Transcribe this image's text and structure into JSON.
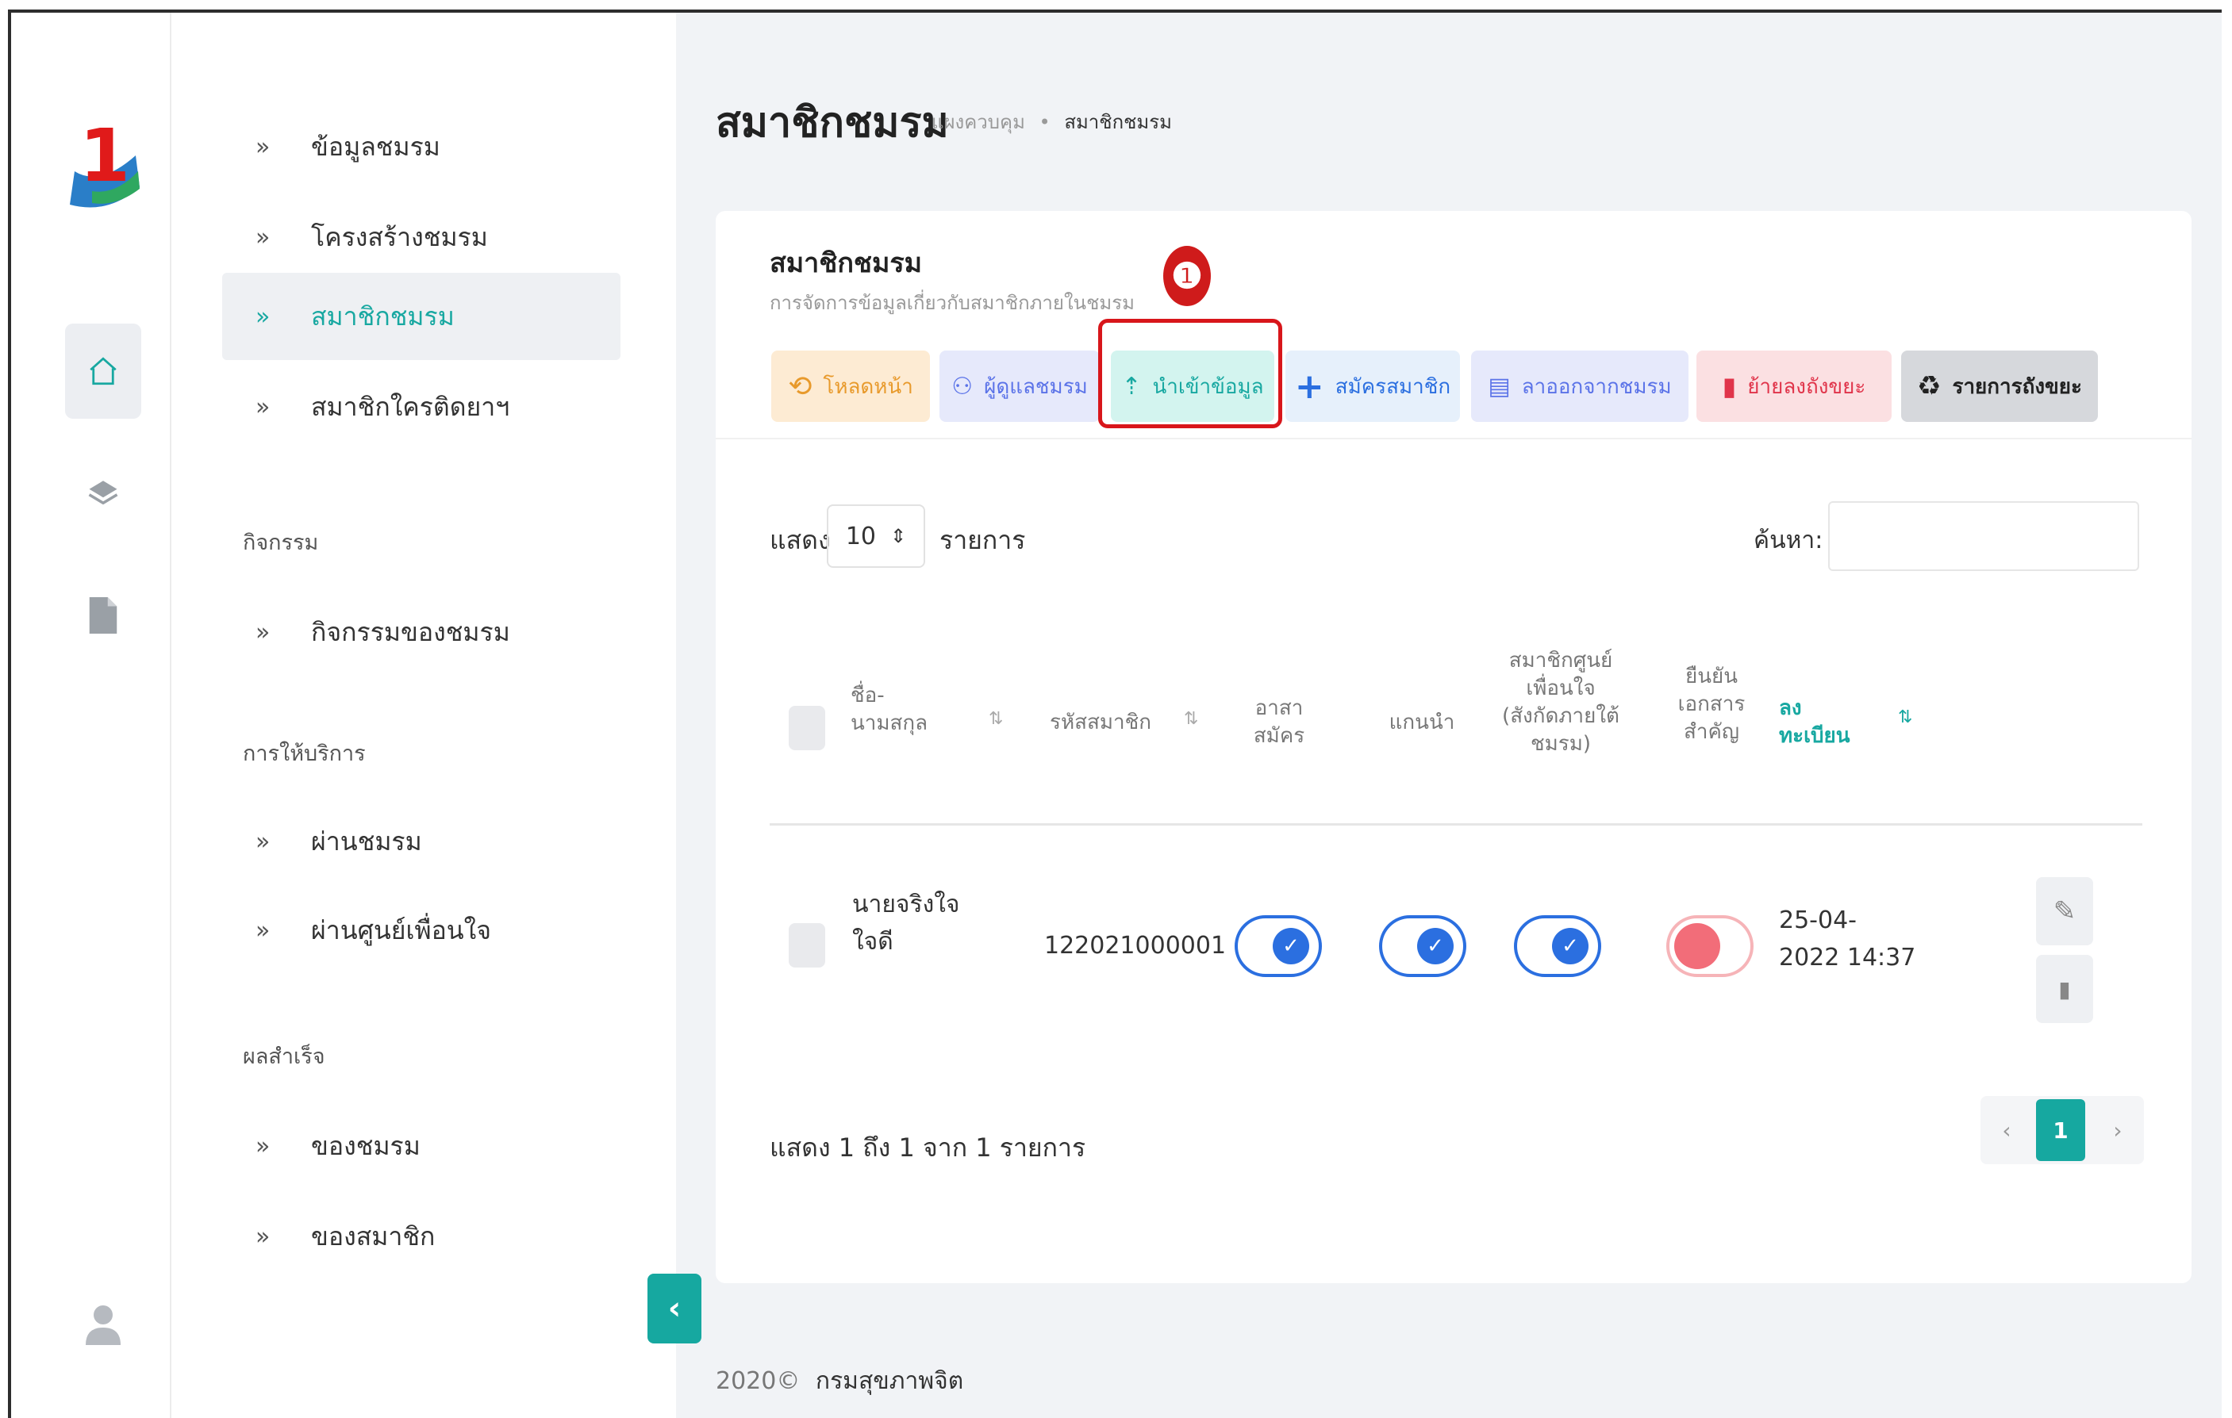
{
  "rail": {
    "logo_text": "1",
    "icons": [
      "home-icon",
      "layers-icon",
      "document-icon",
      "user-icon"
    ]
  },
  "sidebar": {
    "items": [
      {
        "label": "ข้อมูลชมรม"
      },
      {
        "label": "โครงสร้างชมรม"
      },
      {
        "label": "สมาชิกชมรม"
      },
      {
        "label": "สมาชิกใครติดยาฯ"
      }
    ],
    "section_activity": "กิจกรรม",
    "activity_items": [
      {
        "label": "กิจกรรมของชมรม"
      }
    ],
    "section_service": "การให้บริการ",
    "service_items": [
      {
        "label": "ผ่านชมรม"
      },
      {
        "label": "ผ่านศูนย์เพื่อนใจ"
      }
    ],
    "section_result": "ผลสำเร็จ",
    "result_items": [
      {
        "label": "ของชมรม"
      },
      {
        "label": "ของสมาชิก"
      }
    ],
    "chevron": "»",
    "collapse": "‹"
  },
  "header": {
    "title": "สมาชิกชมรม",
    "breadcrumb_home": "แผงควบคุม",
    "breadcrumb_sep": "•",
    "breadcrumb_current": "สมาชิกชมรม"
  },
  "card": {
    "title": "สมาชิกชมรม",
    "subtitle": "การจัดการข้อมูลเกี่ยวกับสมาชิกภายในชมรม"
  },
  "toolbar": {
    "reload": "โหลดหน้า",
    "admin": "ผู้ดูแลชมรม",
    "import": "นำเข้าข้อมูล",
    "register": "สมัครสมาชิก",
    "resign": "ลาออกจากชมรม",
    "trash": "ย้ายลงถังขยะ",
    "trash_list": "รายการถังขยะ"
  },
  "callout": {
    "number": "❶"
  },
  "table_controls": {
    "show_label": "แสดง",
    "page_length": "10",
    "select_arrow": "⇕",
    "after_label": "รายการ",
    "search_label": "ค้นหา:"
  },
  "table": {
    "headers": {
      "name": "ชื่อ-\nนามสกุล",
      "member_id": "รหัสสมาชิก",
      "volunteer": "อาสา\nสมัคร",
      "leader": "แกนนำ",
      "center_member": "สมาชิกศูนย์\nเพื่อนใจ\n(สังกัดภายใต้\nชมรม)",
      "docs_confirmed": "ยืนยัน\nเอกสาร\nสำคัญ",
      "registered": "ลง\nทะเบียน"
    },
    "sort_icon": "⇅",
    "rows": [
      {
        "name": "นายจริงใจ\nใจดี",
        "member_id": "122021000001",
        "volunteer": true,
        "leader": true,
        "center_member": true,
        "docs_confirmed": false,
        "registered": "25-04-\n2022 14:37"
      }
    ]
  },
  "table_info": "แสดง 1 ถึง 1 จาก 1 รายการ",
  "pagination": {
    "prev": "‹",
    "current": "1",
    "next": "›"
  },
  "footer": {
    "year": "2020©",
    "org": "กรมสุขภาพจิต"
  },
  "colors": {
    "accent": "#16a8a0",
    "toggle_on": "#2b6fe0",
    "toggle_off": "#f26d79",
    "callout": "#d8161b"
  }
}
